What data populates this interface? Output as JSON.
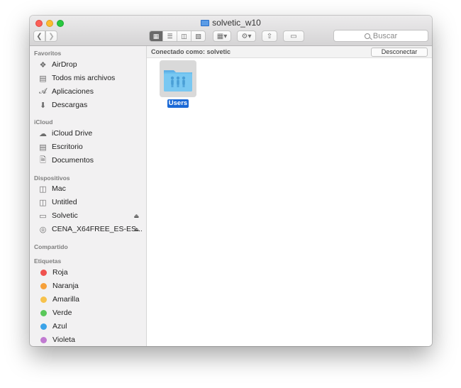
{
  "window": {
    "title": "solvetic_w10"
  },
  "toolbar": {
    "search_placeholder": "Buscar",
    "view_modes": [
      "icons",
      "list",
      "columns",
      "cover-flow"
    ]
  },
  "sidebar": {
    "sections": {
      "favoritos": "Favoritos",
      "icloud": "iCloud",
      "dispositivos": "Dispositivos",
      "compartido": "Compartido",
      "etiquetas": "Etiquetas"
    },
    "favoritos": [
      {
        "label": "AirDrop",
        "icon": "airdrop-icon"
      },
      {
        "label": "Todos mis archivos",
        "icon": "all-files-icon"
      },
      {
        "label": "Aplicaciones",
        "icon": "applications-icon"
      },
      {
        "label": "Descargas",
        "icon": "downloads-icon"
      }
    ],
    "icloud": [
      {
        "label": "iCloud Drive",
        "icon": "cloud-icon"
      },
      {
        "label": "Escritorio",
        "icon": "desktop-icon"
      },
      {
        "label": "Documentos",
        "icon": "documents-icon"
      }
    ],
    "dispositivos": [
      {
        "label": "Mac",
        "icon": "disk-icon"
      },
      {
        "label": "Untitled",
        "icon": "disk-icon"
      },
      {
        "label": "Solvetic",
        "icon": "drive-icon"
      },
      {
        "label": "CENA_X64FREE_ES-ES...",
        "icon": "cd-icon"
      }
    ],
    "etiquetas": [
      {
        "label": "Roja",
        "color": "#f0524f"
      },
      {
        "label": "Naranja",
        "color": "#f6a03a"
      },
      {
        "label": "Amarilla",
        "color": "#f7c24c"
      },
      {
        "label": "Verde",
        "color": "#5ac85a"
      },
      {
        "label": "Azul",
        "color": "#3ba3e8"
      },
      {
        "label": "Violeta",
        "color": "#c17ad1"
      }
    ]
  },
  "main": {
    "connected_as": "Conectado como: solvetic",
    "disconnect_label": "Desconectar",
    "files": [
      {
        "name": "Users",
        "selected": true
      }
    ]
  }
}
